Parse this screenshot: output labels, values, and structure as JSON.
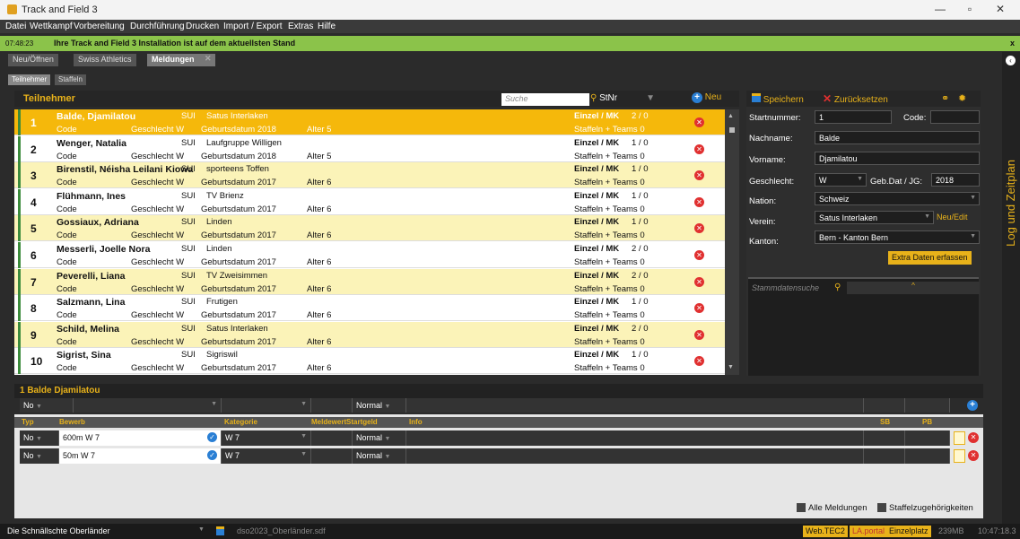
{
  "window": {
    "title": "Track and Field 3"
  },
  "menu": [
    "Datei",
    "Wettkampf",
    "Vorbereitung",
    "Durchführung",
    "Drucken",
    "Import / Export",
    "Extras",
    "Hilfe"
  ],
  "notification": {
    "time": "07:48:23",
    "text": "Ihre Track and Field 3 Installation ist auf dem aktuellsten Stand",
    "close": "x"
  },
  "doc_tabs": [
    "Neu/Öffnen",
    "Swiss Athletics",
    "Meldungen"
  ],
  "sub_tabs": [
    "Teilnehmer",
    "Staffeln"
  ],
  "sidebar": {
    "label": "Log und Zeitplan"
  },
  "teilnehmer": {
    "title": "Teilnehmer",
    "search_placeholder": "Suche",
    "stnr_label": "StNr",
    "new_label": "Neu",
    "rows": [
      {
        "num": "1",
        "name": "Balde, Djamilatou",
        "nat": "SUI",
        "verein": "Satus Interlaken",
        "code": "Code",
        "gesch": "Geschlecht W",
        "geb": "Geburtsdatum 2018",
        "alter": "Alter 5",
        "einzel": "Einzel / MK",
        "frac": "2 / 0",
        "staff": "Staffeln + Teams 0"
      },
      {
        "num": "2",
        "name": "Wenger, Natalia",
        "nat": "SUI",
        "verein": "Laufgruppe Willigen",
        "code": "Code",
        "gesch": "Geschlecht W",
        "geb": "Geburtsdatum 2018",
        "alter": "Alter 5",
        "einzel": "Einzel / MK",
        "frac": "1 / 0",
        "staff": "Staffeln + Teams 0"
      },
      {
        "num": "3",
        "name": "Birenstil, Néisha Leilani Kiowa",
        "nat": "SUI",
        "verein": "sporteens Toffen",
        "code": "Code",
        "gesch": "Geschlecht W",
        "geb": "Geburtsdatum 2017",
        "alter": "Alter 6",
        "einzel": "Einzel / MK",
        "frac": "1 / 0",
        "staff": "Staffeln + Teams 0"
      },
      {
        "num": "4",
        "name": "Flühmann, Ines",
        "nat": "SUI",
        "verein": "TV Brienz",
        "code": "Code",
        "gesch": "Geschlecht W",
        "geb": "Geburtsdatum 2017",
        "alter": "Alter 6",
        "einzel": "Einzel / MK",
        "frac": "1 / 0",
        "staff": "Staffeln + Teams 0"
      },
      {
        "num": "5",
        "name": "Gossiaux, Adriana",
        "nat": "SUI",
        "verein": "Linden",
        "code": "Code",
        "gesch": "Geschlecht W",
        "geb": "Geburtsdatum 2017",
        "alter": "Alter 6",
        "einzel": "Einzel / MK",
        "frac": "1 / 0",
        "staff": "Staffeln + Teams 0"
      },
      {
        "num": "6",
        "name": "Messerli, Joelle Nora",
        "nat": "SUI",
        "verein": "Linden",
        "code": "Code",
        "gesch": "Geschlecht W",
        "geb": "Geburtsdatum 2017",
        "alter": "Alter 6",
        "einzel": "Einzel / MK",
        "frac": "2 / 0",
        "staff": "Staffeln + Teams 0"
      },
      {
        "num": "7",
        "name": "Peverelli, Liana",
        "nat": "SUI",
        "verein": "TV Zweisimmen",
        "code": "Code",
        "gesch": "Geschlecht W",
        "geb": "Geburtsdatum 2017",
        "alter": "Alter 6",
        "einzel": "Einzel / MK",
        "frac": "2 / 0",
        "staff": "Staffeln + Teams 0"
      },
      {
        "num": "8",
        "name": "Salzmann, Lina",
        "nat": "SUI",
        "verein": "Frutigen",
        "code": "Code",
        "gesch": "Geschlecht W",
        "geb": "Geburtsdatum 2017",
        "alter": "Alter 6",
        "einzel": "Einzel / MK",
        "frac": "1 / 0",
        "staff": "Staffeln + Teams 0"
      },
      {
        "num": "9",
        "name": "Schild, Melina",
        "nat": "SUI",
        "verein": "Satus Interlaken",
        "code": "Code",
        "gesch": "Geschlecht W",
        "geb": "Geburtsdatum 2017",
        "alter": "Alter 6",
        "einzel": "Einzel / MK",
        "frac": "2 / 0",
        "staff": "Staffeln + Teams 0"
      },
      {
        "num": "10",
        "name": "Sigrist, Sina",
        "nat": "SUI",
        "verein": "Sigriswil",
        "code": "Code",
        "gesch": "Geschlecht W",
        "geb": "Geburtsdatum 2017",
        "alter": "Alter 6",
        "einzel": "Einzel / MK",
        "frac": "1 / 0",
        "staff": "Staffeln + Teams 0"
      }
    ]
  },
  "detail": {
    "save": "Speichern",
    "reset": "Zurücksetzen",
    "startnummer_label": "Startnummer:",
    "startnummer": "1",
    "code_label": "Code:",
    "nachname_label": "Nachname:",
    "nachname": "Balde",
    "vorname_label": "Vorname:",
    "vorname": "Djamilatou",
    "geschlecht_label": "Geschlecht:",
    "geschlecht": "W",
    "gebdat_label": "Geb.Dat / JG:",
    "gebdat": "2018",
    "nation_label": "Nation:",
    "nation": "Schweiz",
    "verein_label": "Verein:",
    "verein": "Satus Interlaken",
    "neuedit": "Neu/Edit",
    "kanton_label": "Kanton:",
    "kanton": "Bern - Kanton Bern",
    "extra": "Extra Daten erfassen",
    "stamm_placeholder": "Stammdatensuche"
  },
  "meldungen": {
    "title": "1 Balde Djamilatou",
    "filter_typ": "No",
    "filter_startgeld": "Normal",
    "columns": [
      "Typ",
      "Bewerb",
      "Kategorie",
      "Meldewert",
      "Startgeld",
      "Info",
      "SB",
      "PB"
    ],
    "rows": [
      {
        "typ": "No",
        "bewerb": "600m W 7",
        "kategorie": "W 7",
        "startgeld": "Normal"
      },
      {
        "typ": "No",
        "bewerb": "50m W 7",
        "kategorie": "W 7",
        "startgeld": "Normal"
      }
    ],
    "alle": "Alle Meldungen",
    "staffel": "Staffelzugehörigkeiten"
  },
  "status": {
    "club": "Die Schnällschte Oberländer",
    "file": "dso2023_Oberländer.sdf",
    "tags": [
      "Web.TEC2",
      "LA.portal",
      "Einzelplatz"
    ],
    "mem": "239MB",
    "time": "10:47:18.3"
  }
}
